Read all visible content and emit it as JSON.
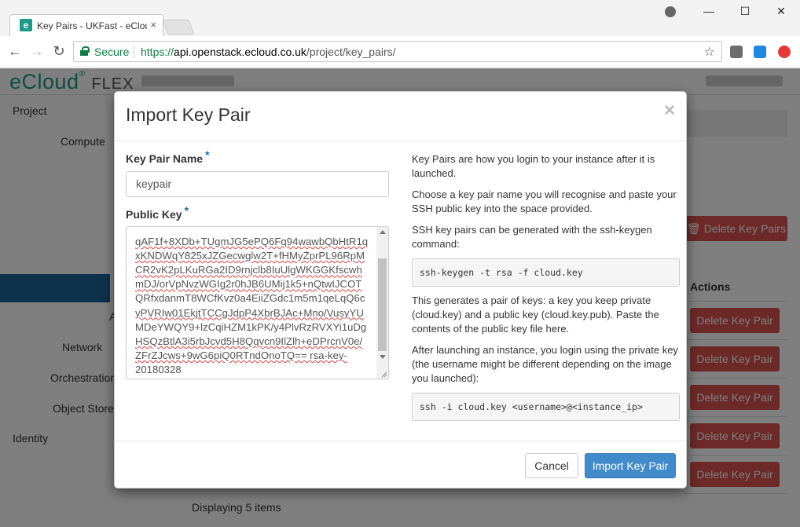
{
  "browser": {
    "tab_title": "Key Pairs - UKFast - eCloud",
    "tab_favicon": "e",
    "tab_close": "×",
    "secure_label": "Secure",
    "url_scheme": "https://",
    "url_host": "api.openstack.ecloud.co.uk",
    "url_path": "/project/key_pairs/",
    "win_minimize": "—",
    "win_maximize": "☐",
    "win_close": "✕",
    "back": "←",
    "forward": "→",
    "reload": "↻",
    "star": "☆"
  },
  "app": {
    "brand": "eCloud",
    "brand_reg": "®",
    "brand_suffix": "FLEX",
    "sidebar": {
      "project": "Project",
      "compute": "Compute",
      "a_partial": "A",
      "network": "Network",
      "orchestration": "Orchestration",
      "object_store": "Object Store",
      "identity": "Identity"
    },
    "delete_all_label": "🗑 Delete Key Pairs",
    "actions_header": "Actions",
    "delete_label": "Delete Key Pair",
    "display_count": "Displaying 5 items"
  },
  "modal": {
    "title": "Import Key Pair",
    "close": "×",
    "name_label": "Key Pair Name",
    "required_mark": "*",
    "name_value": "keypair",
    "key_label": "Public Key",
    "key_lines": [
      "qAF1f+8XDb+TUgmJG5ePQ6Fq94wawbQbHtR1q",
      "xKNDWqY825xJZGecwglw2T+fHMyZprPL96RpM",
      "CR2vK2pLKuRGa2ID9rnjclb8IuUlgWKGGKfscwh",
      "mDJ/orVpNvzWGIg2r0hJB6UMij1k5+nQtwIJCOT",
      "QRfxdanmT8WCfKvz0a4EiiZGdc1m5m1qeLqQ6c",
      "yPVRIw01EkjtTCCgJdpP4XbrBJAc+Mno/VusyYU",
      "MDeYWQY9+lzCqiHZM1kPK/y4PlvRzRVXYi1uDg",
      "HSQzBtlA3i5rbJcvd5H8Qqvcn9IlZlh+eDPrcnV0e/",
      "ZFrZJcws+9wG6piQ0RTndOnoTQ== rsa-key-",
      "20180328"
    ],
    "help": {
      "p1": "Key Pairs are how you login to your instance after it is launched.",
      "p2": "Choose a key pair name you will recognise and paste your SSH public key into the space provided.",
      "p3": "SSH key pairs can be generated with the ssh-keygen command:",
      "code1": "ssh-keygen -t rsa -f cloud.key",
      "p4": "This generates a pair of keys: a key you keep private (cloud.key) and a public key (cloud.key.pub). Paste the contents of the public key file here.",
      "p5": "After launching an instance, you login using the private key (the username might be different depending on the image you launched):",
      "code2": "ssh -i cloud.key <username>@<instance_ip>"
    },
    "cancel_label": "Cancel",
    "submit_label": "Import Key Pair"
  }
}
